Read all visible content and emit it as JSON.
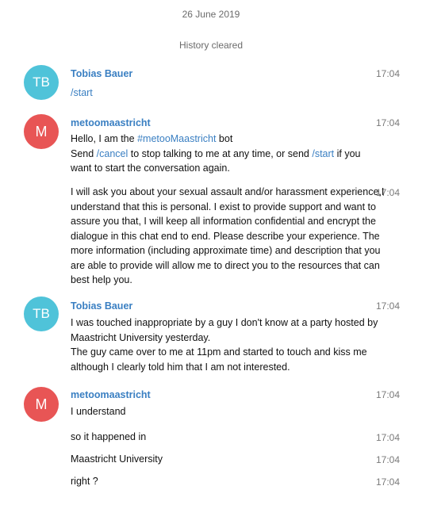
{
  "date_header": "26 June 2019",
  "service_message": "History cleared",
  "colors": {
    "link": "#3a7fc2",
    "avatar_tb": "#4fc3d9",
    "avatar_m": "#e85555"
  },
  "messages": [
    {
      "avatar": "TB",
      "sender": "Tobias Bauer",
      "time": "17:04",
      "text": "/start"
    },
    {
      "avatar": "M",
      "sender": "metoomaastricht",
      "time": "17:04",
      "line1_a": "Hello, I am the ",
      "line1_tag": "#metooMaastricht",
      "line1_b": " bot",
      "line2_a": "Send ",
      "line2_cmd1": "/cancel",
      "line2_b": " to stop talking to me at any time, or send ",
      "line2_cmd2": "/start",
      "line2_c": " if you",
      "line3": "want to start the conversation again."
    },
    {
      "time": "17:04",
      "text": "I will ask you about your sexual assault and/or harassment experience,I understand that this is personal. I exist to provide support and want to assure you that, I will keep all information confidential and encrypt the dialogue in this chat end to end. Please describe your experience. The more information (including approximate time) and description that you are able to provide will allow me to direct you to the resources that can best help you."
    },
    {
      "avatar": "TB",
      "sender": "Tobias Bauer",
      "time": "17:04",
      "text": "I was touched inappropriate by a guy I don't know at a party hosted by Maastricht University yesterday.\nThe guy came over to me at 11pm and started to touch and kiss me although I clearly told him that I am not interested."
    },
    {
      "avatar": "M",
      "sender": "metoomaastricht",
      "time": "17:04",
      "text": "I understand"
    },
    {
      "time": "17:04",
      "text": "so it happened in"
    },
    {
      "time": "17:04",
      "text": "Maastricht University"
    },
    {
      "time": "17:04",
      "text": "right ?"
    }
  ]
}
